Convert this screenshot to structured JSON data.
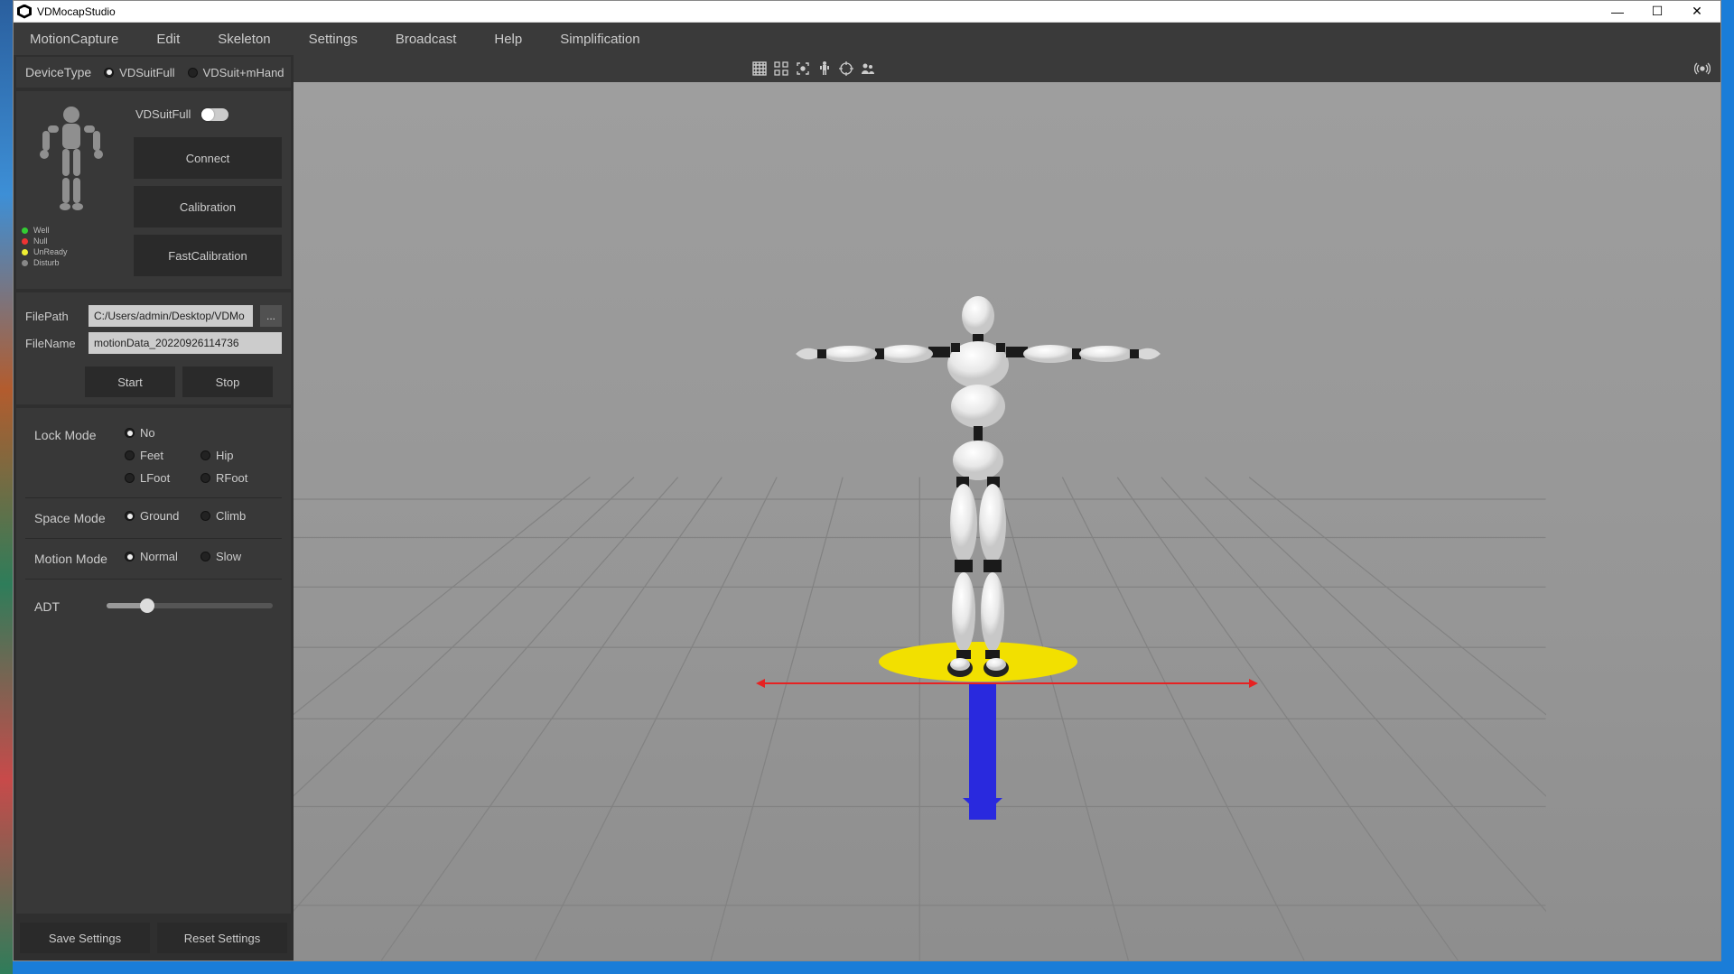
{
  "window": {
    "title": "VDMocapStudio"
  },
  "menu": {
    "motion_capture": "MotionCapture",
    "edit": "Edit",
    "skeleton": "Skeleton",
    "settings": "Settings",
    "broadcast": "Broadcast",
    "help": "Help",
    "simplification": "Simplification"
  },
  "device": {
    "label": "DeviceType",
    "opt_full": "VDSuitFull",
    "opt_mhand": "VDSuit+mHand",
    "selected": "VDSuitFull",
    "suit_label": "VDSuitFull",
    "connect": "Connect",
    "calibration": "Calibration",
    "fast_cal": "FastCalibration",
    "legend": {
      "well": "Well",
      "null": "Null",
      "unready": "UnReady",
      "disturb": "Disturb"
    }
  },
  "file": {
    "path_label": "FilePath",
    "path_value": "C:/Users/admin/Desktop/VDMo",
    "name_label": "FileName",
    "name_value": "motionData_20220926114736",
    "start": "Start",
    "stop": "Stop"
  },
  "lock_mode": {
    "label": "Lock Mode",
    "no": "No",
    "feet": "Feet",
    "hip": "Hip",
    "lfoot": "LFoot",
    "rfoot": "RFoot",
    "selected": "No"
  },
  "space_mode": {
    "label": "Space Mode",
    "ground": "Ground",
    "climb": "Climb",
    "selected": "Ground"
  },
  "motion_mode": {
    "label": "Motion Mode",
    "normal": "Normal",
    "slow": "Slow",
    "selected": "Normal"
  },
  "adt": {
    "label": "ADT",
    "value": 20
  },
  "footer": {
    "save": "Save Settings",
    "reset": "Reset Settings"
  }
}
